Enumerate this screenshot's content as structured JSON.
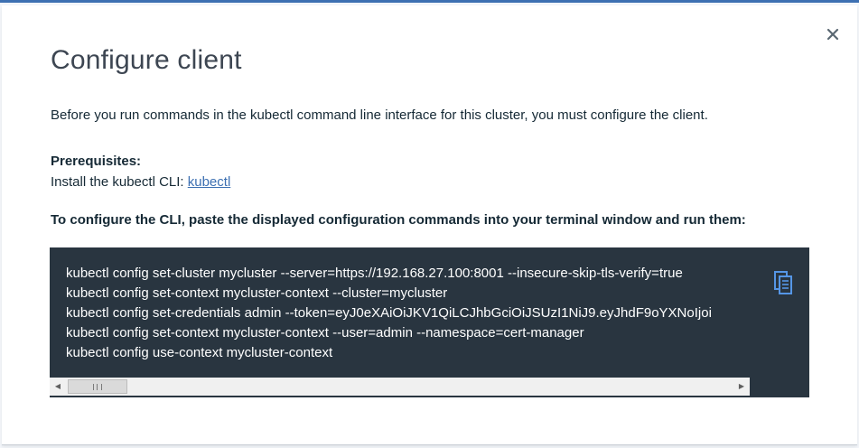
{
  "modal": {
    "title": "Configure client",
    "intro": "Before you run commands in the kubectl command line interface for this cluster, you must configure the client.",
    "prerequisites": {
      "heading": "Prerequisites:",
      "install_text": "Install the kubectl CLI: ",
      "link_label": "kubectl"
    },
    "instructions": "To configure the CLI, paste the displayed configuration commands into your terminal window and run them:",
    "commands": [
      "kubectl config set-cluster mycluster --server=https://192.168.27.100:8001 --insecure-skip-tls-verify=true",
      "kubectl config set-context mycluster-context --cluster=mycluster",
      "kubectl config set-credentials admin --token=eyJ0eXAiOiJKV1QiLCJhbGciOiJSUzI1NiJ9.eyJhdF9oYXNoIjoi",
      "kubectl config set-context mycluster-context --user=admin --namespace=cert-manager",
      "kubectl config use-context mycluster-context"
    ],
    "icons": {
      "close": "close-icon",
      "copy": "copy-icon"
    }
  },
  "colors": {
    "accent": "#3d70b2",
    "code_background": "#293540",
    "text": "#152935"
  }
}
